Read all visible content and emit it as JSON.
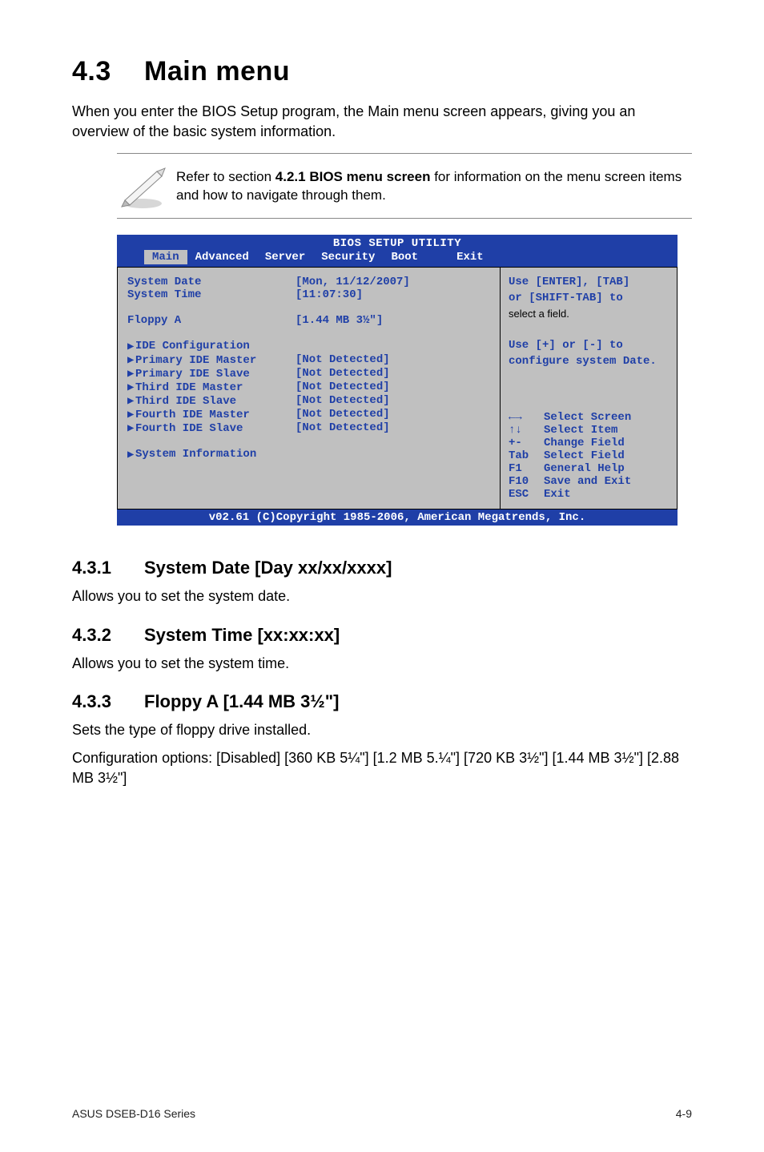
{
  "h1_num": "4.3",
  "h1_title": "Main menu",
  "intro": "When you enter the BIOS Setup program, the Main menu screen appears, giving you an overview of the basic system information.",
  "note_prefix": "Refer to section ",
  "note_bold": "4.2.1 BIOS menu screen",
  "note_suffix": " for information on the menu screen items and how to navigate through them.",
  "bios": {
    "title": "BIOS SETUP UTILITY",
    "tabs": {
      "t0": "Main",
      "t1": "Advanced",
      "t2": "Server",
      "t3": "Security",
      "t4": "Boot",
      "t5": "Exit"
    },
    "rows": {
      "date_lbl": "System Date",
      "date_val": "[Mon, 11/12/2007]",
      "time_lbl": "System Time",
      "time_val": "[11:07:30]",
      "floppy_lbl": "Floppy A",
      "floppy_val": "[1.44 MB 3½\"]",
      "idecfg": "IDE Configuration",
      "pmaster_lbl": "Primary IDE Master",
      "pmaster_val": "[Not Detected]",
      "pslave_lbl": "Primary IDE Slave",
      "pslave_val": "[Not Detected]",
      "tmaster_lbl": "Third IDE Master",
      "tmaster_val": "[Not Detected]",
      "tslave_lbl": "Third IDE Slave",
      "tslave_val": "[Not Detected]",
      "fmaster_lbl": "Fourth IDE Master",
      "fmaster_val": "[Not Detected]",
      "fslave_lbl": "Fourth IDE Slave",
      "fslave_val": "[Not Detected]",
      "sysinfo": "System Information"
    },
    "help": {
      "l1": "Use [ENTER], [TAB]",
      "l2": "or [SHIFT-TAB] to",
      "l3": "select a field.",
      "l4": "Use [+] or [-] to",
      "l5": "configure system Date.",
      "k1k": "←→",
      "k1v": "Select Screen",
      "k2k": "↑↓",
      "k2v": "Select Item",
      "k3k": "+-",
      "k3v": "Change Field",
      "k4k": "Tab",
      "k4v": "Select Field",
      "k5k": "F1",
      "k5v": "General Help",
      "k6k": "F10",
      "k6v": "Save and Exit",
      "k7k": "ESC",
      "k7v": "Exit"
    },
    "foot": "v02.61 (C)Copyright 1985-2006, American Megatrends, Inc."
  },
  "s431_num": "4.3.1",
  "s431_title": "System Date [Day xx/xx/xxxx]",
  "s431_text": "Allows you to set the system date.",
  "s432_num": "4.3.2",
  "s432_title": "System Time [xx:xx:xx]",
  "s432_text": "Allows you to set the system time.",
  "s433_num": "4.3.3",
  "s433_title": "Floppy A [1.44 MB 3½\"]",
  "s433_text1": "Sets the type of floppy drive installed.",
  "s433_text2": "Configuration options: [Disabled] [360 KB 5¼\"] [1.2 MB 5.¼\"] [720 KB 3½\"] [1.44 MB 3½\"] [2.88 MB 3½\"]",
  "footer": "ASUS DSEB-D16 Series",
  "pagenum": "4-9"
}
